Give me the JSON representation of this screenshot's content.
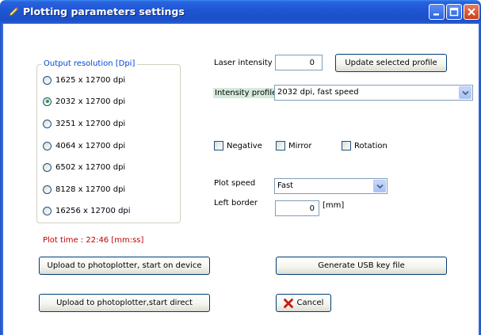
{
  "window": {
    "title": "Plotting parameters settings",
    "title_color": "#1f55d2"
  },
  "resolution": {
    "legend": "Output resolution [Dpi]",
    "options": [
      {
        "label": "1625 x 12700 dpi",
        "selected": false
      },
      {
        "label": "2032 x 12700 dpi",
        "selected": true
      },
      {
        "label": "3251 x 12700 dpi",
        "selected": false
      },
      {
        "label": "4064 x 12700 dpi",
        "selected": false
      },
      {
        "label": "6502 x 12700 dpi",
        "selected": false
      },
      {
        "label": "8128 x 12700 dpi",
        "selected": false
      },
      {
        "label": "16256 x 12700 dpi",
        "selected": false
      }
    ]
  },
  "laser": {
    "label": "Laser intensity",
    "value": "0",
    "update_button": "Update selected profile"
  },
  "profile": {
    "label": "Intensity profile",
    "value": "2032 dpi, fast speed"
  },
  "options": {
    "negative": "Negative",
    "mirror": "Mirror",
    "rotation": "Rotation"
  },
  "speed": {
    "label": "Plot speed",
    "value": "Fast"
  },
  "border": {
    "label": "Left border",
    "value": "0",
    "unit": "[mm]"
  },
  "plot_time": "Plot time : 22:46   [mm:ss]",
  "buttons": {
    "upload_device": "Upload to photoplotter, start on device",
    "generate_usb": "Generate USB key file",
    "upload_direct": "Upload to photoplotter,start direct",
    "cancel": "Cancel"
  }
}
